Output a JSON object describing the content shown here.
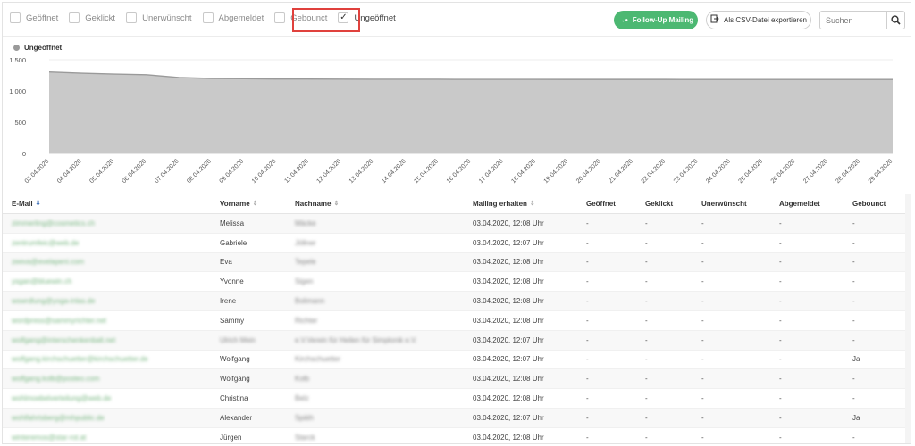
{
  "filters": [
    {
      "label": "Geöffnet",
      "checked": false
    },
    {
      "label": "Geklickt",
      "checked": false
    },
    {
      "label": "Unerwünscht",
      "checked": false
    },
    {
      "label": "Abgemeldet",
      "checked": false
    },
    {
      "label": "Gebounct",
      "checked": false
    },
    {
      "label": "Ungeöffnet",
      "checked": true
    }
  ],
  "toolbar": {
    "follow_up_label": "Follow-Up Mailing",
    "export_label": "Als CSV-Datei exportieren",
    "search_placeholder": "Suchen"
  },
  "colors": {
    "accent_green": "#4cb872",
    "highlight_red": "#e0413d",
    "area_fill": "#c9c9c9",
    "area_stroke": "#9a9a9a"
  },
  "chart_data": {
    "type": "area",
    "legend": [
      "Ungeöffnet"
    ],
    "legend_position": "top-left",
    "grid": true,
    "ylim": [
      0,
      1500
    ],
    "y_ticks": [
      "0",
      "500",
      "1 000",
      "1 500"
    ],
    "y_tick_values": [
      0,
      500,
      1000,
      1500
    ],
    "x": [
      "03.04.2020",
      "04.04.2020",
      "05.04.2020",
      "06.04.2020",
      "07.04.2020",
      "08.04.2020",
      "09.04.2020",
      "10.04.2020",
      "11.04.2020",
      "12.04.2020",
      "13.04.2020",
      "14.04.2020",
      "15.04.2020",
      "16.04.2020",
      "17.04.2020",
      "18.04.2020",
      "19.04.2020",
      "20.04.2020",
      "21.04.2020",
      "22.04.2020",
      "23.04.2020",
      "24.04.2020",
      "25.04.2020",
      "26.04.2020",
      "27.04.2020",
      "28.04.2020",
      "29.04.2020"
    ],
    "series": [
      {
        "name": "Ungeöffnet",
        "values": [
          1305,
          1285,
          1270,
          1260,
          1215,
          1200,
          1195,
          1190,
          1190,
          1188,
          1187,
          1186,
          1186,
          1185,
          1185,
          1185,
          1184,
          1184,
          1184,
          1184,
          1183,
          1183,
          1183,
          1183,
          1183,
          1183,
          1183
        ]
      }
    ]
  },
  "table": {
    "columns": [
      {
        "key": "email",
        "label": "E-Mail",
        "sort": "desc"
      },
      {
        "key": "vorname",
        "label": "Vorname",
        "sort": "none"
      },
      {
        "key": "nachname",
        "label": "Nachname",
        "sort": "none"
      },
      {
        "key": "mailing",
        "label": "Mailing erhalten",
        "sort": "none"
      },
      {
        "key": "geoeffnet",
        "label": "Geöffnet"
      },
      {
        "key": "geklickt",
        "label": "Geklickt"
      },
      {
        "key": "unerwuenscht",
        "label": "Unerwünscht"
      },
      {
        "key": "abgemeldet",
        "label": "Abgemeldet"
      },
      {
        "key": "gebounct",
        "label": "Gebounct"
      }
    ],
    "rows": [
      {
        "email": "zimmerling@cosmetics.ch",
        "vorname": "Melissa",
        "nachname": "Mäcke",
        "mailing": "03.04.2020, 12:08 Uhr",
        "geoeffnet": "-",
        "geklickt": "-",
        "unerwuenscht": "-",
        "abgemeldet": "-",
        "gebounct": "-"
      },
      {
        "email": "zentrumfeic@web.de",
        "vorname": "Gabriele",
        "nachname": "Jöllner",
        "mailing": "03.04.2020, 12:07 Uhr",
        "geoeffnet": "-",
        "geklickt": "-",
        "unerwuenscht": "-",
        "abgemeldet": "-",
        "gebounct": "-"
      },
      {
        "email": "zeeva@evelapeni.com",
        "vorname": "Eva",
        "nachname": "Tepele",
        "mailing": "03.04.2020, 12:08 Uhr",
        "geoeffnet": "-",
        "geklickt": "-",
        "unerwuenscht": "-",
        "abgemeldet": "-",
        "gebounct": "-"
      },
      {
        "email": "ysgan@bluewin.ch",
        "vorname": "Yvonne",
        "nachname": "Sigen",
        "mailing": "03.04.2020, 12:08 Uhr",
        "geoeffnet": "-",
        "geklickt": "-",
        "unerwuenscht": "-",
        "abgemeldet": "-",
        "gebounct": "-"
      },
      {
        "email": "wswrdlung@yoga-inlas.de",
        "vorname": "Irene",
        "nachname": "Bolimann",
        "mailing": "03.04.2020, 12:08 Uhr",
        "geoeffnet": "-",
        "geklickt": "-",
        "unerwuenscht": "-",
        "abgemeldet": "-",
        "gebounct": "-"
      },
      {
        "email": "wordpress@sammyrichter.net",
        "vorname": "Sammy",
        "nachname": "Richter",
        "mailing": "03.04.2020, 12:08 Uhr",
        "geoeffnet": "-",
        "geklickt": "-",
        "unerwuenscht": "-",
        "abgemeldet": "-",
        "gebounct": "-"
      },
      {
        "email": "wolfgang@interschenkenbalt.net",
        "vorname": "Ulrich Mein",
        "nachname": "e.V.Verein für Heilen für Simplonik e.V.",
        "mailing": "03.04.2020, 12:07 Uhr",
        "geoeffnet": "-",
        "geklickt": "-",
        "unerwuenscht": "-",
        "abgemeldet": "-",
        "gebounct": "-"
      },
      {
        "email": "wolfgang.kirchschuetter@kirchschuetter.de",
        "vorname": "Wolfgang",
        "nachname": "Kirchschuetter",
        "mailing": "03.04.2020, 12:07 Uhr",
        "geoeffnet": "-",
        "geklickt": "-",
        "unerwuenscht": "-",
        "abgemeldet": "-",
        "gebounct": "Ja"
      },
      {
        "email": "wolfgang.kolb@posteo.com",
        "vorname": "Wolfgang",
        "nachname": "Kolb",
        "mailing": "03.04.2020, 12:08 Uhr",
        "geoeffnet": "-",
        "geklickt": "-",
        "unerwuenscht": "-",
        "abgemeldet": "-",
        "gebounct": "-"
      },
      {
        "email": "wohlmoebelverteilung@web.de",
        "vorname": "Christina",
        "nachname": "Belz",
        "mailing": "03.04.2020, 12:08 Uhr",
        "geoeffnet": "-",
        "geklickt": "-",
        "unerwuenscht": "-",
        "abgemeldet": "-",
        "gebounct": "-"
      },
      {
        "email": "wohlfahrtsberg@mhpublic.de",
        "vorname": "Alexander",
        "nachname": "Späth",
        "mailing": "03.04.2020, 12:07 Uhr",
        "geoeffnet": "-",
        "geklickt": "-",
        "unerwuenscht": "-",
        "abgemeldet": "-",
        "gebounct": "Ja"
      },
      {
        "email": "winteremos@star-rot.at",
        "vorname": "Jürgen",
        "nachname": "Starck",
        "mailing": "03.04.2020, 12:08 Uhr",
        "geoeffnet": "-",
        "geklickt": "-",
        "unerwuenscht": "-",
        "abgemeldet": "-",
        "gebounct": "-"
      }
    ]
  }
}
